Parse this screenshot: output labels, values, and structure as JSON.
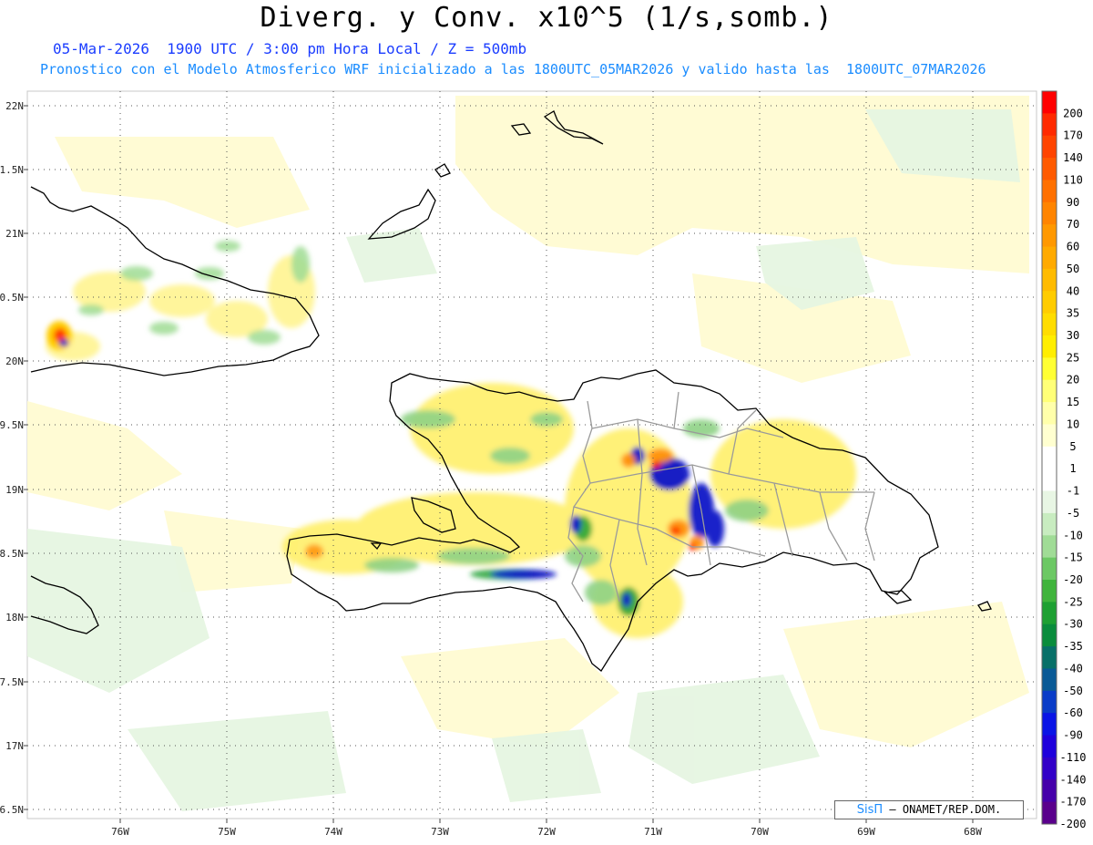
{
  "header": {
    "title": "Diverg. y Conv. x10^5 (1/s,somb.)",
    "subtitle_time": "05-Mar-2026  1900 UTC / 3:00 pm Hora Local / Z = 500mb",
    "subtitle_model": "Pronostico con el Modelo Atmosferico WRF inicializado a las 1800UTC_05MAR2026 y valido hasta las  1800UTC_07MAR2026"
  },
  "map": {
    "lat_labels": [
      "22N",
      "1.5N",
      "21N",
      "0.5N",
      "20N",
      "9.5N",
      "19N",
      "8.5N",
      "18N",
      "7.5N",
      "17N",
      "6.5N"
    ],
    "lon_labels": [
      "76W",
      "75W",
      "74W",
      "73W",
      "72W",
      "71W",
      "70W",
      "69W",
      "68W"
    ],
    "grid": "dotted",
    "region": "Hispaniola / Cuba oriental"
  },
  "colorbar": {
    "levels": [
      "200",
      "170",
      "140",
      "110",
      "90",
      "70",
      "60",
      "50",
      "40",
      "35",
      "30",
      "25",
      "20",
      "15",
      "10",
      "5",
      "1",
      "-1",
      "-5",
      "-10",
      "-15",
      "-20",
      "-25",
      "-30",
      "-35",
      "-40",
      "-50",
      "-60",
      "-90",
      "-110",
      "-140",
      "-170",
      "-200"
    ],
    "colors": [
      "#ff0000",
      "#ff2a00",
      "#ff4400",
      "#ff5a00",
      "#ff7000",
      "#ff8400",
      "#ff9800",
      "#ffaa00",
      "#ffbb00",
      "#ffcc00",
      "#ffdd00",
      "#ffee00",
      "#ffff33",
      "#ffff77",
      "#ffffaa",
      "#ffffd0",
      "#ffffff",
      "#ffffff",
      "#e8f6e4",
      "#c8ecc0",
      "#a0dc96",
      "#6cc864",
      "#40b43c",
      "#1ea032",
      "#0a8c3c",
      "#087068",
      "#0a5a96",
      "#0a3cc8",
      "#0a14e6",
      "#1e00dc",
      "#3200c8",
      "#4600aa",
      "#5a008c"
    ]
  },
  "credit": {
    "brand": "SisΠ",
    "text": "– ONAMET/REP.DOM."
  }
}
